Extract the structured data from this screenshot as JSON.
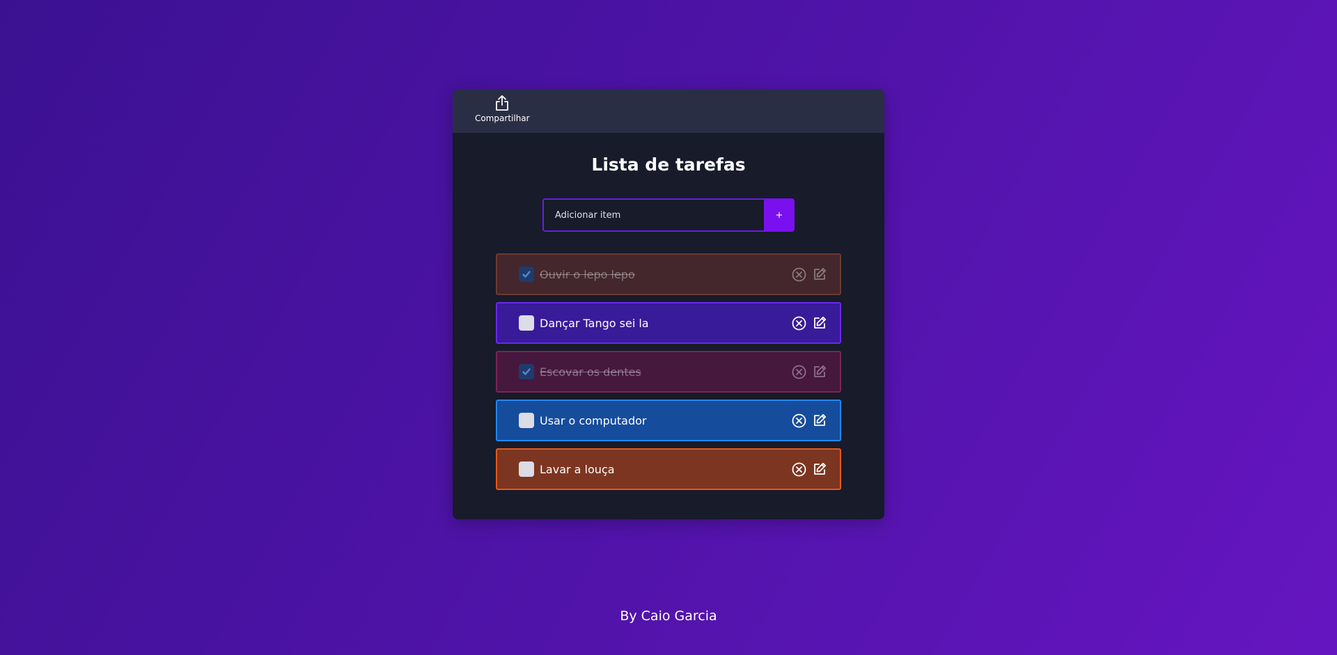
{
  "toolbar": {
    "share_label": "Compartilhar",
    "share_icon": "share-upload-icon"
  },
  "page": {
    "title": "Lista de tarefas",
    "footer": "By Caio Garcia"
  },
  "add_form": {
    "placeholder": "Adicionar item",
    "button_label": "+"
  },
  "colors": {
    "accent": "#7a10f0",
    "card_bg": "#171b2a",
    "topbar_bg": "#2a2e45"
  },
  "items": [
    {
      "text": "Ouvir o lepo lepo",
      "done": true,
      "bg": "#43272c",
      "border": "#6e3a2e"
    },
    {
      "text": "Dançar Tango sei la",
      "done": false,
      "bg": "#381b99",
      "border": "#6a28ef"
    },
    {
      "text": "Escovar os dentes",
      "done": true,
      "bg": "#46183e",
      "border": "#7a2455"
    },
    {
      "text": "Usar o computador",
      "done": false,
      "bg": "#164c9c",
      "border": "#2487ee"
    },
    {
      "text": "Lavar a louça",
      "done": false,
      "bg": "#7c3520",
      "border": "#e55a1c"
    }
  ],
  "item_icons": {
    "delete": "close-circle-icon",
    "edit": "edit-icon",
    "check": "check-icon"
  }
}
